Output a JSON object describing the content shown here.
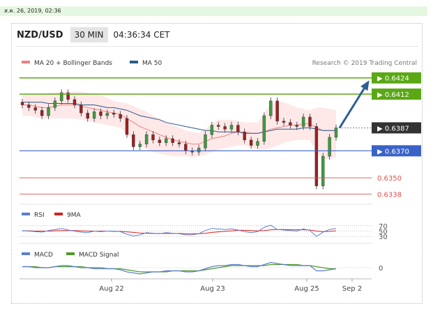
{
  "date_stamp": "ส.ค. 26, 2019, 02:36",
  "header": {
    "pair": "NZD/USD",
    "timeframe": "30 MIN",
    "clock": "04:36:34 CET"
  },
  "legend": {
    "ma20_label": "MA 20 + Bollinger Bands",
    "ma50_label": "MA 50",
    "credit": "Research © 2019 Trading Central"
  },
  "colors": {
    "ma20": "#f08080",
    "ma50": "#2b5a8c",
    "band": "#fde0e0",
    "resistance": "#5aa815",
    "pivot": "#3a63c8",
    "support": "#d9534f",
    "candle_up": "#3f9b3f",
    "candle_down": "#9b2020",
    "arrow": "#2d5e94",
    "last_price": "#333333",
    "rsi": "#5b7fcf",
    "rsi_ma": "#d92020",
    "macd": "#5b7fcf",
    "macd_signal": "#4e9a28"
  },
  "chart_data": {
    "type": "candlestick",
    "instrument": "NZD/USD",
    "interval": "30 MIN",
    "x_ticks": [
      "Aug 22",
      "Aug 23",
      "Aug 25",
      "Sep 2"
    ],
    "y_range": [
      0.6333,
      0.6428
    ],
    "price_levels": [
      {
        "type": "resistance",
        "value": 0.6424,
        "label": "0.6424"
      },
      {
        "type": "resistance",
        "value": 0.6412,
        "label": "0.6412"
      },
      {
        "type": "last",
        "value": 0.6387,
        "label": "0.6387"
      },
      {
        "type": "pivot",
        "value": 0.637,
        "label": "0.6370"
      },
      {
        "type": "support",
        "value": 0.635,
        "label": "0.6350"
      },
      {
        "type": "support",
        "value": 0.6338,
        "label": "0.6338"
      }
    ],
    "forecast_arrow": {
      "from": 0.6387,
      "to": 0.6424
    },
    "close_series": [
      0.6404,
      0.6402,
      0.64,
      0.6396,
      0.6402,
      0.6407,
      0.6413,
      0.6408,
      0.6404,
      0.6398,
      0.6394,
      0.6399,
      0.6396,
      0.6398,
      0.6397,
      0.6394,
      0.6382,
      0.6373,
      0.6375,
      0.6382,
      0.6378,
      0.6376,
      0.6379,
      0.6376,
      0.6375,
      0.637,
      0.6369,
      0.6372,
      0.6382,
      0.6389,
      0.6388,
      0.6386,
      0.6389,
      0.6384,
      0.6378,
      0.6374,
      0.6377,
      0.6396,
      0.6407,
      0.6392,
      0.6391,
      0.6389,
      0.6388,
      0.6395,
      0.6388,
      0.6344,
      0.6366,
      0.638,
      0.6387
    ],
    "ma20": [
      0.6404,
      0.6404,
      0.6403,
      0.6402,
      0.6402,
      0.6403,
      0.6404,
      0.6404,
      0.6404,
      0.6403,
      0.6402,
      0.6401,
      0.64,
      0.6399,
      0.6398,
      0.6397,
      0.6394,
      0.6391,
      0.6388,
      0.6386,
      0.6384,
      0.6382,
      0.638,
      0.6378,
      0.6377,
      0.6376,
      0.6375,
      0.6375,
      0.6377,
      0.6379,
      0.638,
      0.6381,
      0.6383,
      0.6384,
      0.6384,
      0.6383,
      0.6383,
      0.6384,
      0.6386,
      0.6387,
      0.6388,
      0.6389,
      0.6389,
      0.639,
      0.639,
      0.6387,
      0.6385,
      0.6385,
      0.6385
    ],
    "ma50": [
      0.6406,
      0.6406,
      0.6406,
      0.6406,
      0.6405,
      0.6405,
      0.6405,
      0.6405,
      0.6405,
      0.6404,
      0.6404,
      0.6404,
      0.6403,
      0.6402,
      0.6402,
      0.6401,
      0.64,
      0.6398,
      0.6396,
      0.6395,
      0.6394,
      0.6393,
      0.6391,
      0.639,
      0.6389,
      0.6388,
      0.6387,
      0.6386,
      0.6385,
      0.6385,
      0.6384,
      0.6384,
      0.6384,
      0.6384,
      0.6383,
      0.6383,
      0.6383,
      0.6384,
      0.6385,
      0.6386,
      0.6386,
      0.6386,
      0.6386,
      0.6387,
      0.6387,
      0.6386,
      0.6385,
      0.6385,
      0.6385
    ],
    "bollinger_upper": [
      0.6411,
      0.6412,
      0.6412,
      0.6412,
      0.6413,
      0.6413,
      0.6414,
      0.6414,
      0.6414,
      0.6414,
      0.6413,
      0.6412,
      0.6411,
      0.6409,
      0.6407,
      0.6406,
      0.6405,
      0.6403,
      0.6401,
      0.6399,
      0.6396,
      0.6394,
      0.6391,
      0.6389,
      0.6387,
      0.6385,
      0.6384,
      0.6383,
      0.6386,
      0.639,
      0.6393,
      0.6393,
      0.6393,
      0.6392,
      0.6391,
      0.6391,
      0.6391,
      0.6398,
      0.6405,
      0.6407,
      0.6406,
      0.6404,
      0.6402,
      0.6401,
      0.64,
      0.6402,
      0.6402,
      0.6401,
      0.64
    ],
    "bollinger_lower": [
      0.6396,
      0.6396,
      0.6395,
      0.6394,
      0.6394,
      0.6394,
      0.6394,
      0.6394,
      0.6394,
      0.6393,
      0.6392,
      0.6391,
      0.639,
      0.6389,
      0.6388,
      0.6387,
      0.6382,
      0.6378,
      0.6374,
      0.6371,
      0.6369,
      0.6368,
      0.6367,
      0.6366,
      0.6366,
      0.6366,
      0.6365,
      0.6366,
      0.6367,
      0.6369,
      0.6371,
      0.6372,
      0.6373,
      0.6374,
      0.6374,
      0.6372,
      0.6371,
      0.6371,
      0.6372,
      0.6374,
      0.6376,
      0.6377,
      0.6378,
      0.6378,
      0.6378,
      0.6369,
      0.6364,
      0.6364,
      0.6365
    ],
    "rsi": {
      "labels": [
        "RSI",
        "9MA"
      ],
      "levels": [
        70,
        50,
        30
      ],
      "y_range": [
        20,
        80
      ],
      "values": [
        52,
        50,
        48,
        46,
        52,
        56,
        60,
        54,
        50,
        46,
        44,
        50,
        48,
        50,
        50,
        48,
        38,
        32,
        36,
        44,
        42,
        40,
        44,
        42,
        40,
        36,
        36,
        40,
        52,
        60,
        58,
        56,
        58,
        54,
        48,
        44,
        48,
        64,
        72,
        56,
        54,
        52,
        50,
        58,
        52,
        30,
        46,
        56,
        60
      ],
      "ma": [
        51,
        51,
        50,
        50,
        50,
        51,
        52,
        52,
        52,
        51,
        50,
        50,
        50,
        50,
        49,
        49,
        47,
        45,
        43,
        42,
        41,
        41,
        41,
        41,
        41,
        40,
        40,
        40,
        42,
        45,
        47,
        49,
        51,
        53,
        53,
        52,
        51,
        52,
        55,
        56,
        56,
        55,
        55,
        55,
        54,
        50,
        48,
        49,
        51
      ]
    },
    "macd": {
      "labels": [
        "MACD",
        "MACD Signal"
      ],
      "zero_label": "0",
      "y_range": [
        -0.0008,
        0.0008
      ],
      "macd": [
        0.0001,
        0.0001,
        0.0,
        0.0,
        0.0,
        0.0001,
        0.0002,
        0.0002,
        0.0001,
        0.0,
        0.0,
        -0.0001,
        -0.0001,
        -0.0001,
        -0.0001,
        -0.0002,
        -0.0004,
        -0.0005,
        -0.0006,
        -0.0005,
        -0.0004,
        -0.0004,
        -0.0003,
        -0.0003,
        -0.0003,
        -0.0004,
        -0.0004,
        -0.0003,
        -0.0001,
        0.0001,
        0.0002,
        0.0002,
        0.0003,
        0.0003,
        0.0002,
        0.0001,
        0.0001,
        0.0003,
        0.0005,
        0.0004,
        0.0003,
        0.0002,
        0.0002,
        0.0002,
        0.0002,
        -0.0003,
        -0.0003,
        -0.0002,
        -0.0001
      ],
      "signal": [
        0.0001,
        0.0001,
        0.0001,
        0.0,
        0.0,
        0.0001,
        0.0001,
        0.0001,
        0.0001,
        0.0001,
        0.0,
        0.0,
        0.0,
        -0.0001,
        -0.0001,
        -0.0001,
        -0.0002,
        -0.0003,
        -0.0004,
        -0.0004,
        -0.0004,
        -0.0004,
        -0.0004,
        -0.0003,
        -0.0003,
        -0.0003,
        -0.0003,
        -0.0003,
        -0.0002,
        -0.0001,
        0.0,
        0.0001,
        0.0002,
        0.0002,
        0.0002,
        0.0002,
        0.0002,
        0.0002,
        0.0003,
        0.0003,
        0.0003,
        0.0003,
        0.0003,
        0.0002,
        0.0002,
        0.0001,
        0.0,
        -0.0001,
        -0.0001
      ]
    }
  }
}
